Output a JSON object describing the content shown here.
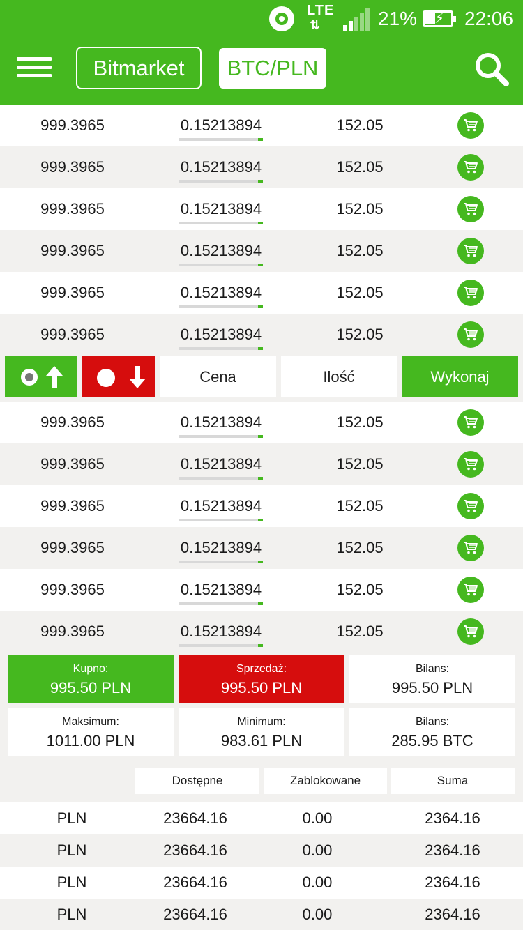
{
  "status_bar": {
    "network": "LTE",
    "network_arrows": "⇅",
    "battery": "21%",
    "time": "22:06",
    "icons": [
      "beats-icon",
      "lte-icon",
      "signal-icon",
      "battery-charging-icon"
    ]
  },
  "header": {
    "menu_icon": "hamburger-menu-icon",
    "market_label": "Bitmarket",
    "pair_label": "BTC/PLN",
    "search_icon": "search-icon"
  },
  "orders_top": [
    {
      "col1": "999.3965",
      "col2": "0.15213894",
      "col3": "152.05"
    },
    {
      "col1": "999.3965",
      "col2": "0.15213894",
      "col3": "152.05"
    },
    {
      "col1": "999.3965",
      "col2": "0.15213894",
      "col3": "152.05"
    },
    {
      "col1": "999.3965",
      "col2": "0.15213894",
      "col3": "152.05"
    },
    {
      "col1": "999.3965",
      "col2": "0.15213894",
      "col3": "152.05"
    },
    {
      "col1": "999.3965",
      "col2": "0.15213894",
      "col3": "152.05"
    }
  ],
  "order_form": {
    "buy_icon": "arrow-up-icon",
    "sell_icon": "arrow-down-icon",
    "price_placeholder": "Cena",
    "amount_placeholder": "Ilość",
    "execute_label": "Wykonaj"
  },
  "orders_bottom": [
    {
      "col1": "999.3965",
      "col2": "0.15213894",
      "col3": "152.05"
    },
    {
      "col1": "999.3965",
      "col2": "0.15213894",
      "col3": "152.05"
    },
    {
      "col1": "999.3965",
      "col2": "0.15213894",
      "col3": "152.05"
    },
    {
      "col1": "999.3965",
      "col2": "0.15213894",
      "col3": "152.05"
    },
    {
      "col1": "999.3965",
      "col2": "0.15213894",
      "col3": "152.05"
    },
    {
      "col1": "999.3965",
      "col2": "0.15213894",
      "col3": "152.05"
    }
  ],
  "summary": {
    "buy": {
      "label": "Kupno:",
      "value": "995.50 PLN"
    },
    "sell": {
      "label": "Sprzedaż:",
      "value": "995.50 PLN"
    },
    "balance_pln": {
      "label": "Bilans:",
      "value": "995.50 PLN"
    },
    "max": {
      "label": "Maksimum:",
      "value": "1011.00 PLN"
    },
    "min": {
      "label": "Minimum:",
      "value": "983.61 PLN"
    },
    "balance_btc": {
      "label": "Bilans:",
      "value": "285.95 BTC"
    }
  },
  "balances": {
    "headers": [
      "Dostępne",
      "Zablokowane",
      "Suma"
    ],
    "rows": [
      {
        "currency": "PLN",
        "available": "23664.16",
        "locked": "0.00",
        "total": "2364.16"
      },
      {
        "currency": "PLN",
        "available": "23664.16",
        "locked": "0.00",
        "total": "2364.16"
      },
      {
        "currency": "PLN",
        "available": "23664.16",
        "locked": "0.00",
        "total": "2364.16"
      },
      {
        "currency": "PLN",
        "available": "23664.16",
        "locked": "0.00",
        "total": "2364.16"
      }
    ]
  },
  "colors": {
    "brand_green": "#45b81f",
    "sell_red": "#d60d0d",
    "row_alt": "#f2f1ef"
  }
}
